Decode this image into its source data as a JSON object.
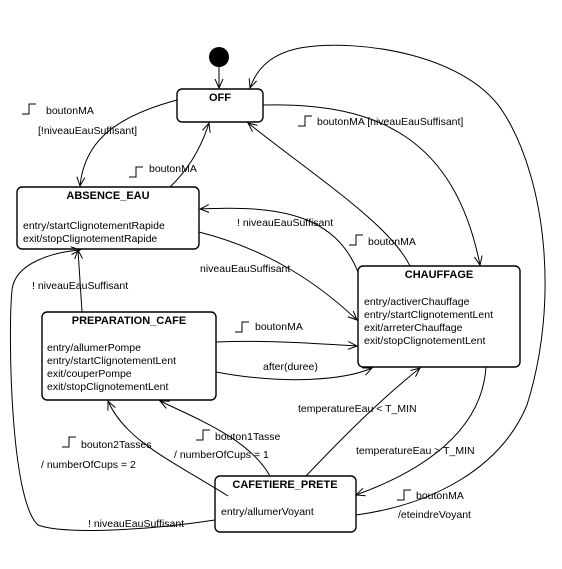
{
  "states": {
    "off": {
      "title": "OFF",
      "lines": []
    },
    "absence": {
      "title": "ABSENCE_EAU",
      "lines": [
        "entry/startClignotementRapide",
        "exit/stopClignotementRapide"
      ]
    },
    "chauffage": {
      "title": "CHAUFFAGE",
      "lines": [
        "entry/activerChauffage",
        "entry/startClignotementLent",
        "exit/arreterChauffage",
        "exit/stopClignotementLent"
      ]
    },
    "prep": {
      "title": "PREPARATION_CAFE",
      "lines": [
        "entry/allumerPompe",
        "entry/startClignotementLent",
        "exit/couperPompe",
        "exit/stopClignotementLent"
      ]
    },
    "prete": {
      "title": "CAFETIERE_PRETE",
      "lines": [
        "entry/allumerVoyant"
      ]
    }
  },
  "transitions": {
    "off_absence": [
      "boutonMA",
      "[!niveauEauSuffisant]"
    ],
    "absence_off": [
      "boutonMA"
    ],
    "off_chauffage": [
      "boutonMA [niveauEauSuffisant]"
    ],
    "chauffage_absence": [
      "! niveauEauSuffisant"
    ],
    "chauffage_off": [
      "boutonMA"
    ],
    "absence_chauffage": [
      "niveauEauSuffisant"
    ],
    "prep_absence": [
      "! niveauEauSuffisant"
    ],
    "prep_chauffage_ma": [
      "boutonMA"
    ],
    "prep_chauffage_duree": [
      "after(duree)"
    ],
    "prete_chauffage": [
      "temperatureEau < T_MIN"
    ],
    "chauffage_prete": [
      "temperatureEau > T_MIN"
    ],
    "prete_prep_2": [
      "bouton2Tasses",
      "/ numberOfCups = 2"
    ],
    "prete_prep_1": [
      "bouton1Tasse",
      "/ numberOfCups = 1"
    ],
    "prete_absence": [
      "! niveauEauSuffisant"
    ],
    "prete_off": [
      "boutonMA",
      "/eteindreVoyant"
    ]
  }
}
